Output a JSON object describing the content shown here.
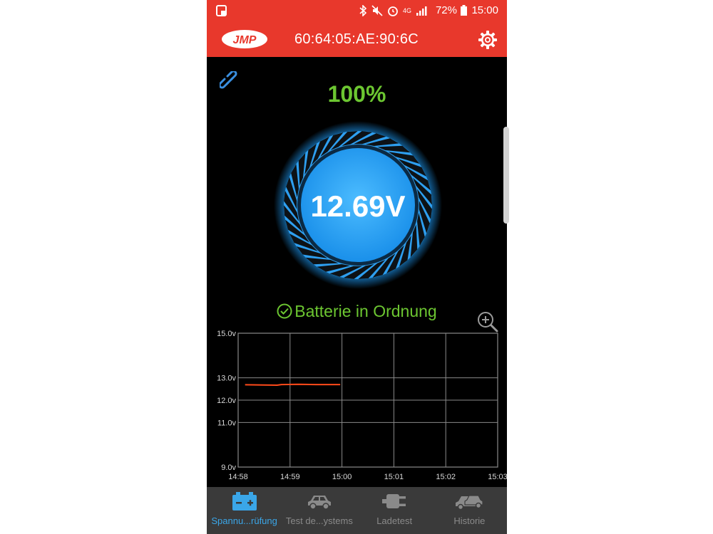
{
  "status_bar": {
    "battery": "72%",
    "time": "15:00",
    "network": "4G"
  },
  "header": {
    "logo_text": "JMP",
    "device_id": "60:64:05:AE:90:6C"
  },
  "main": {
    "charge_percent": "100%",
    "voltage": "12.69V",
    "status": "Batterie in Ordnung"
  },
  "chart_data": {
    "type": "line",
    "title": "",
    "xlabel": "",
    "ylabel": "",
    "x_ticks": [
      "14:58",
      "14:59",
      "15:00",
      "15:01",
      "15:02",
      "15:03"
    ],
    "y_ticks": [
      "9.0v",
      "11.0v",
      "12.0v",
      "13.0v",
      "15.0v"
    ],
    "ylim": [
      9.0,
      15.0
    ],
    "grid": true,
    "series": [
      {
        "color": "#ff4a1a",
        "x": [
          "14:58:08",
          "14:58:30",
          "14:58:45",
          "14:58:50",
          "14:59:10",
          "14:59:30",
          "14:59:55",
          "14:59:58"
        ],
        "y": [
          12.69,
          12.68,
          12.67,
          12.7,
          12.71,
          12.7,
          12.7,
          12.7
        ]
      }
    ]
  },
  "bottom_nav": {
    "items": [
      {
        "label": "Spannu...rüfung",
        "icon": "battery-icon",
        "active": true
      },
      {
        "label": "Test de...ystems",
        "icon": "car-icon",
        "active": false
      },
      {
        "label": "Ladetest",
        "icon": "plug-icon",
        "active": false
      },
      {
        "label": "Historie",
        "icon": "car-compare-icon",
        "active": false
      }
    ]
  },
  "colors": {
    "header": "#e8382c",
    "accent_green": "#6cc631",
    "accent_blue": "#3aa6e8",
    "line": "#ff4a1a"
  }
}
